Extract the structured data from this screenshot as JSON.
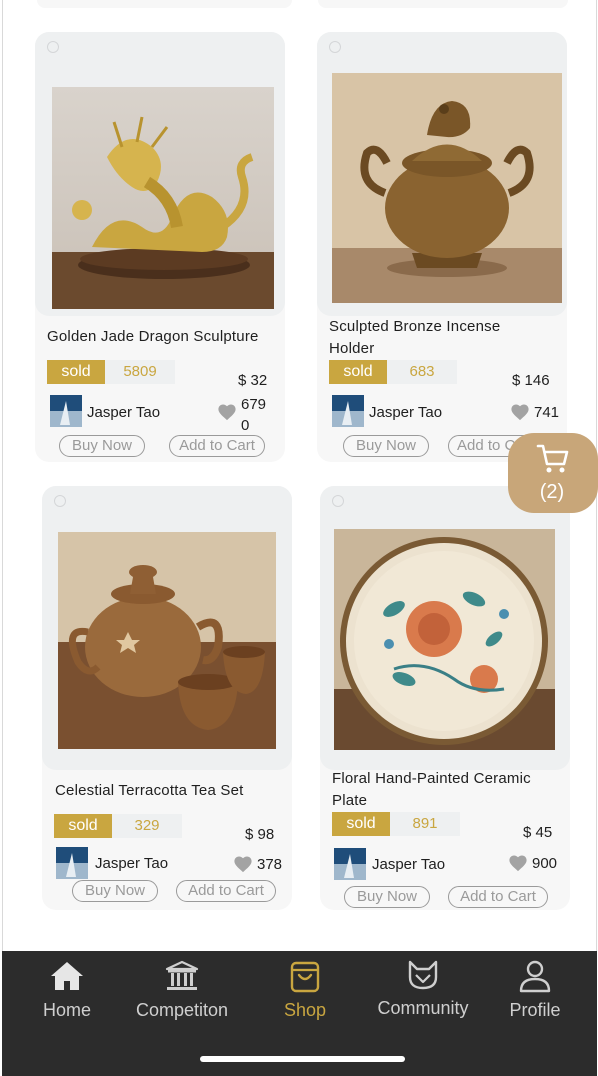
{
  "products": [
    {
      "title": "Golden Jade Dragon Sculpture",
      "title_line2": "",
      "sold_label": "sold",
      "sold_count": "5809",
      "price": "$ 32",
      "seller": "Jasper Tao",
      "likes": "679\n0",
      "buy_label": "Buy Now",
      "cart_label": "Add to Cart"
    },
    {
      "title": "Sculpted Bronze Incense",
      "title_line2": "Holder",
      "sold_label": "sold",
      "sold_count": "683",
      "price": "$ 146",
      "seller": "Jasper Tao",
      "likes": "741",
      "buy_label": "Buy Now",
      "cart_label": "Add to C"
    },
    {
      "title": "Celestial Terracotta Tea Set",
      "title_line2": "",
      "sold_label": "sold",
      "sold_count": "329",
      "price": "$ 98",
      "seller": "Jasper Tao",
      "likes": "378",
      "buy_label": "Buy Now",
      "cart_label": "Add to Cart"
    },
    {
      "title": "Floral Hand-Painted Ceramic",
      "title_line2": "Plate",
      "sold_label": "sold",
      "sold_count": "891",
      "price": "$ 45",
      "seller": "Jasper Tao",
      "likes": "900",
      "buy_label": "Buy Now",
      "cart_label": "Add to Cart"
    }
  ],
  "cart": {
    "count_label": "(2)"
  },
  "tabbar": {
    "items": [
      {
        "label": "Home",
        "icon": "home-icon"
      },
      {
        "label": "Competiton",
        "icon": "museum-icon"
      },
      {
        "label": "Shop",
        "icon": "shopping-bag-icon",
        "active": true
      },
      {
        "label": "Community",
        "icon": "cat-face-icon"
      },
      {
        "label": "Profile",
        "icon": "person-icon"
      }
    ]
  },
  "colors": {
    "accent": "#c9a640",
    "tabbar_bg": "#2c2c2c",
    "cart_fab": "#c8a679"
  }
}
